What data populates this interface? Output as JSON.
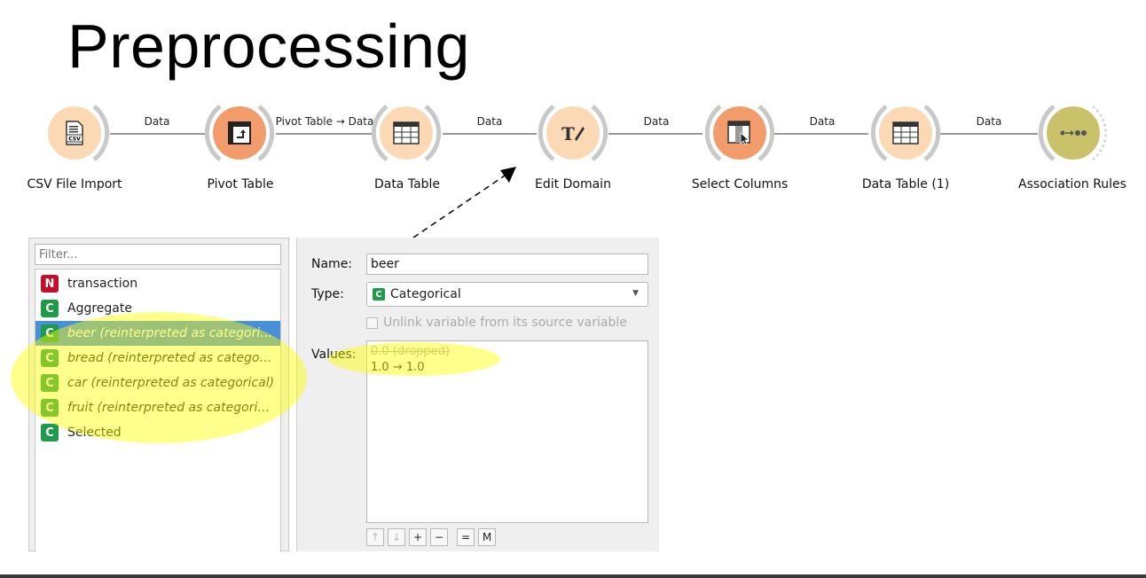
{
  "slide": {
    "title": "Preprocessing"
  },
  "workflow": {
    "nodes": [
      {
        "label": "CSV File Import",
        "icon": "csv-file-icon"
      },
      {
        "label": "Pivot Table",
        "icon": "pivot-icon"
      },
      {
        "label": "Data Table",
        "icon": "table-icon"
      },
      {
        "label": "Edit Domain",
        "icon": "edit-text-icon"
      },
      {
        "label": "Select Columns",
        "icon": "select-columns-icon"
      },
      {
        "label": "Data Table (1)",
        "icon": "table-icon"
      },
      {
        "label": "Association Rules",
        "icon": "association-icon"
      }
    ],
    "links": [
      "Data",
      "Pivot Table → Data",
      "Data",
      "Data",
      "Data",
      "Data"
    ]
  },
  "editor": {
    "filter_placeholder": "Filter...",
    "variables": [
      {
        "type": "N",
        "name": "transaction"
      },
      {
        "type": "C",
        "name": "Aggregate"
      },
      {
        "type": "C",
        "name": "beer (reinterpreted as categori…"
      },
      {
        "type": "C",
        "name": "bread (reinterpreted as catego…"
      },
      {
        "type": "C",
        "name": "car (reinterpreted as categorical)"
      },
      {
        "type": "C",
        "name": "fruit (reinterpreted as categori…"
      },
      {
        "type": "C",
        "name": "Selected"
      }
    ],
    "name_label": "Name:",
    "name_value": "beer",
    "type_label": "Type:",
    "type_badge": "C",
    "type_value": "Categorical",
    "unlink_label": "Unlink variable from its source variable",
    "values_label": "Values:",
    "values": [
      "0.0 (dropped)",
      "1.0 → 1.0"
    ],
    "buttons": [
      "↑",
      "↓",
      "+",
      "−",
      "=",
      "M"
    ]
  },
  "colors": {
    "node_fill": "#fbd9b4",
    "node_fill_active": "#f39c6b",
    "association_fill": "#c9c26a",
    "badge_numeric": "#c0102b",
    "badge_categorical": "#1e9a4a",
    "selection": "#4a90d9",
    "highlight": "#ffff00"
  }
}
